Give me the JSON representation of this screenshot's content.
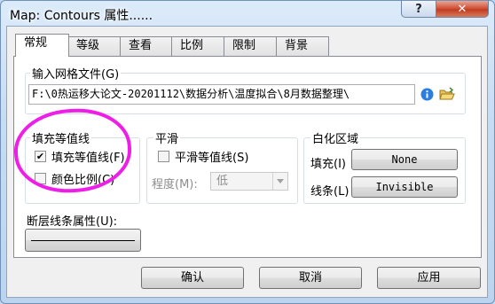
{
  "window": {
    "title": "Map: Contours 属性......",
    "help_glyph": "?",
    "close_glyph": "✕"
  },
  "tabs": [
    {
      "label": "常规",
      "active": true
    },
    {
      "label": "等级",
      "active": false
    },
    {
      "label": "查看",
      "active": false
    },
    {
      "label": "比例",
      "active": false
    },
    {
      "label": "限制",
      "active": false
    },
    {
      "label": "背景",
      "active": false
    }
  ],
  "grid_file": {
    "label": "输入网格文件(G)",
    "path": "F:\\0热运移大论文-20201112\\数据分析\\温度拟合\\8月数据整理\\",
    "info_icon": "info-icon",
    "open_icon": "open-folder-icon"
  },
  "fill_contours": {
    "title": "填充等值线",
    "fill_checkbox": {
      "label": "填充等值线(F)",
      "checked": true
    },
    "color_scale_checkbox": {
      "label": "颜色比例(C)",
      "checked": false
    }
  },
  "smoothing": {
    "title": "平滑",
    "smooth_checkbox": {
      "label": "平滑等值线(S)",
      "checked": false
    },
    "level_label": "程度(M):",
    "level_value": "低"
  },
  "blanked_regions": {
    "title": "白化区域",
    "fill_label": "填充(I)",
    "fill_value": "None",
    "line_label": "线条(L)",
    "line_value": "Invisible"
  },
  "fault_line": {
    "label": "断层线条属性(U):"
  },
  "buttons": {
    "ok": "确认",
    "cancel": "取消",
    "apply": "应用"
  },
  "colors": {
    "annotation": "#ee1ee8",
    "info_icon": "#2a7de1",
    "close_button": "#c94a2f"
  }
}
